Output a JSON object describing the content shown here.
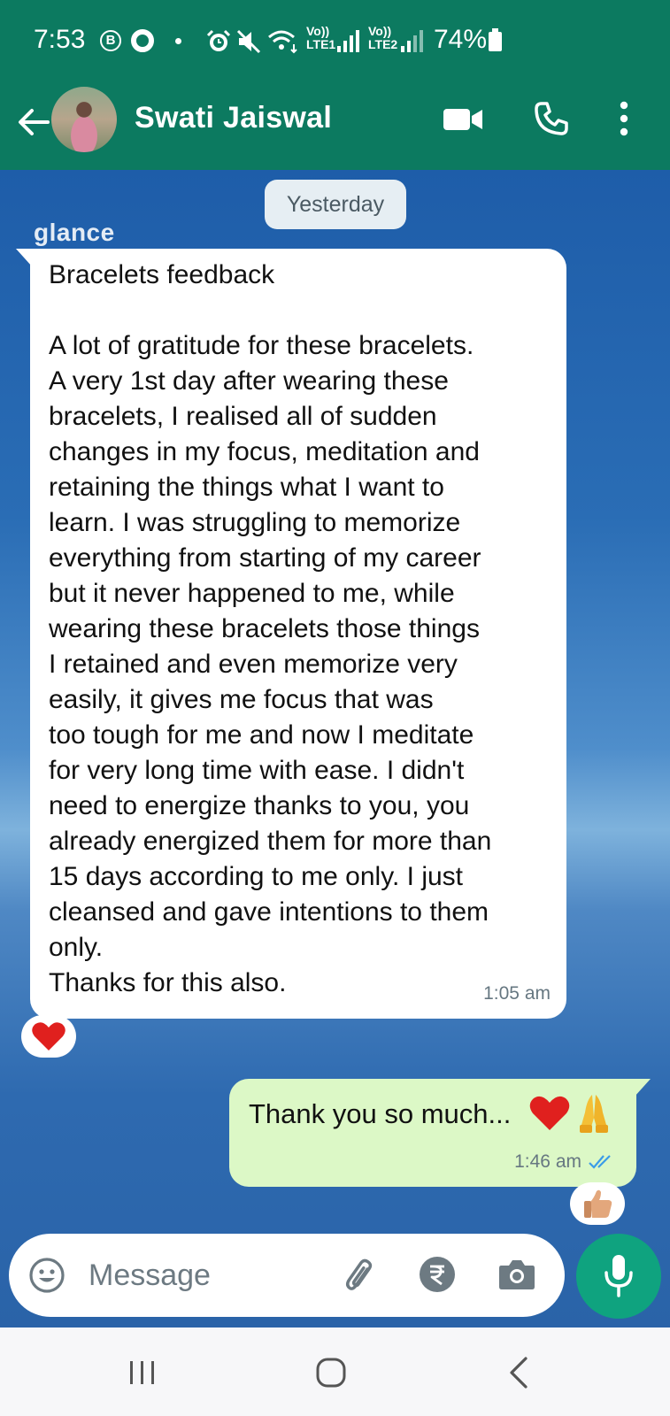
{
  "status_bar": {
    "time": "7:53",
    "b_icon": "B",
    "battery_percent": "74%",
    "sim1_label": "LTE1",
    "sim2_label": "LTE2",
    "volte_label": "Vo))",
    "icons": [
      "b-circle-icon",
      "ring-icon",
      "alarm-icon",
      "mute-icon",
      "wifi-icon",
      "signal-icon",
      "battery-icon"
    ]
  },
  "header": {
    "contact_name": "Swati Jaiswal",
    "icons": [
      "back-arrow-icon",
      "video-call-icon",
      "phone-call-icon",
      "more-options-icon"
    ],
    "color": "#0c7a60"
  },
  "chat": {
    "wallpaper_logo": "glance",
    "date_chip": "Yesterday",
    "incoming": {
      "text": "Bracelets feedback\n\nA lot of gratitude for these bracelets.\nA very 1st day after wearing these\nbracelets, I realised all of sudden\nchanges in my focus, meditation and\nretaining the things what I want to\nlearn. I was struggling to memorize\neverything from starting of my career\nbut it never happened to me, while\nwearing these bracelets those things\nI retained and even memorize very\neasily, it gives me focus that was\ntoo tough for me and now I meditate\nfor very long time with ease. I didn't\nneed to energize thanks to you, you\nalready energized them for more than\n15 days according to me only. I just\ncleansed and gave intentions to them\nonly.\nThanks for this also.",
      "time": "1:05 am",
      "reaction": "red-heart-emoji"
    },
    "outgoing": {
      "text": "Thank you so much...",
      "emojis": [
        "red-heart-emoji",
        "folded-hands-emoji"
      ],
      "time": "1:46 am",
      "status": "read-double-tick",
      "reaction": "thumbs-up-emoji",
      "bubble_color": "#dcf8c6"
    }
  },
  "composer": {
    "placeholder": "Message",
    "icons": [
      "emoji-icon",
      "attach-icon",
      "rupee-payment-icon",
      "camera-icon",
      "mic-icon"
    ],
    "mic_color": "#0fa37f"
  },
  "nav_bar": {
    "icons": [
      "recents-icon",
      "home-icon",
      "back-icon"
    ]
  }
}
